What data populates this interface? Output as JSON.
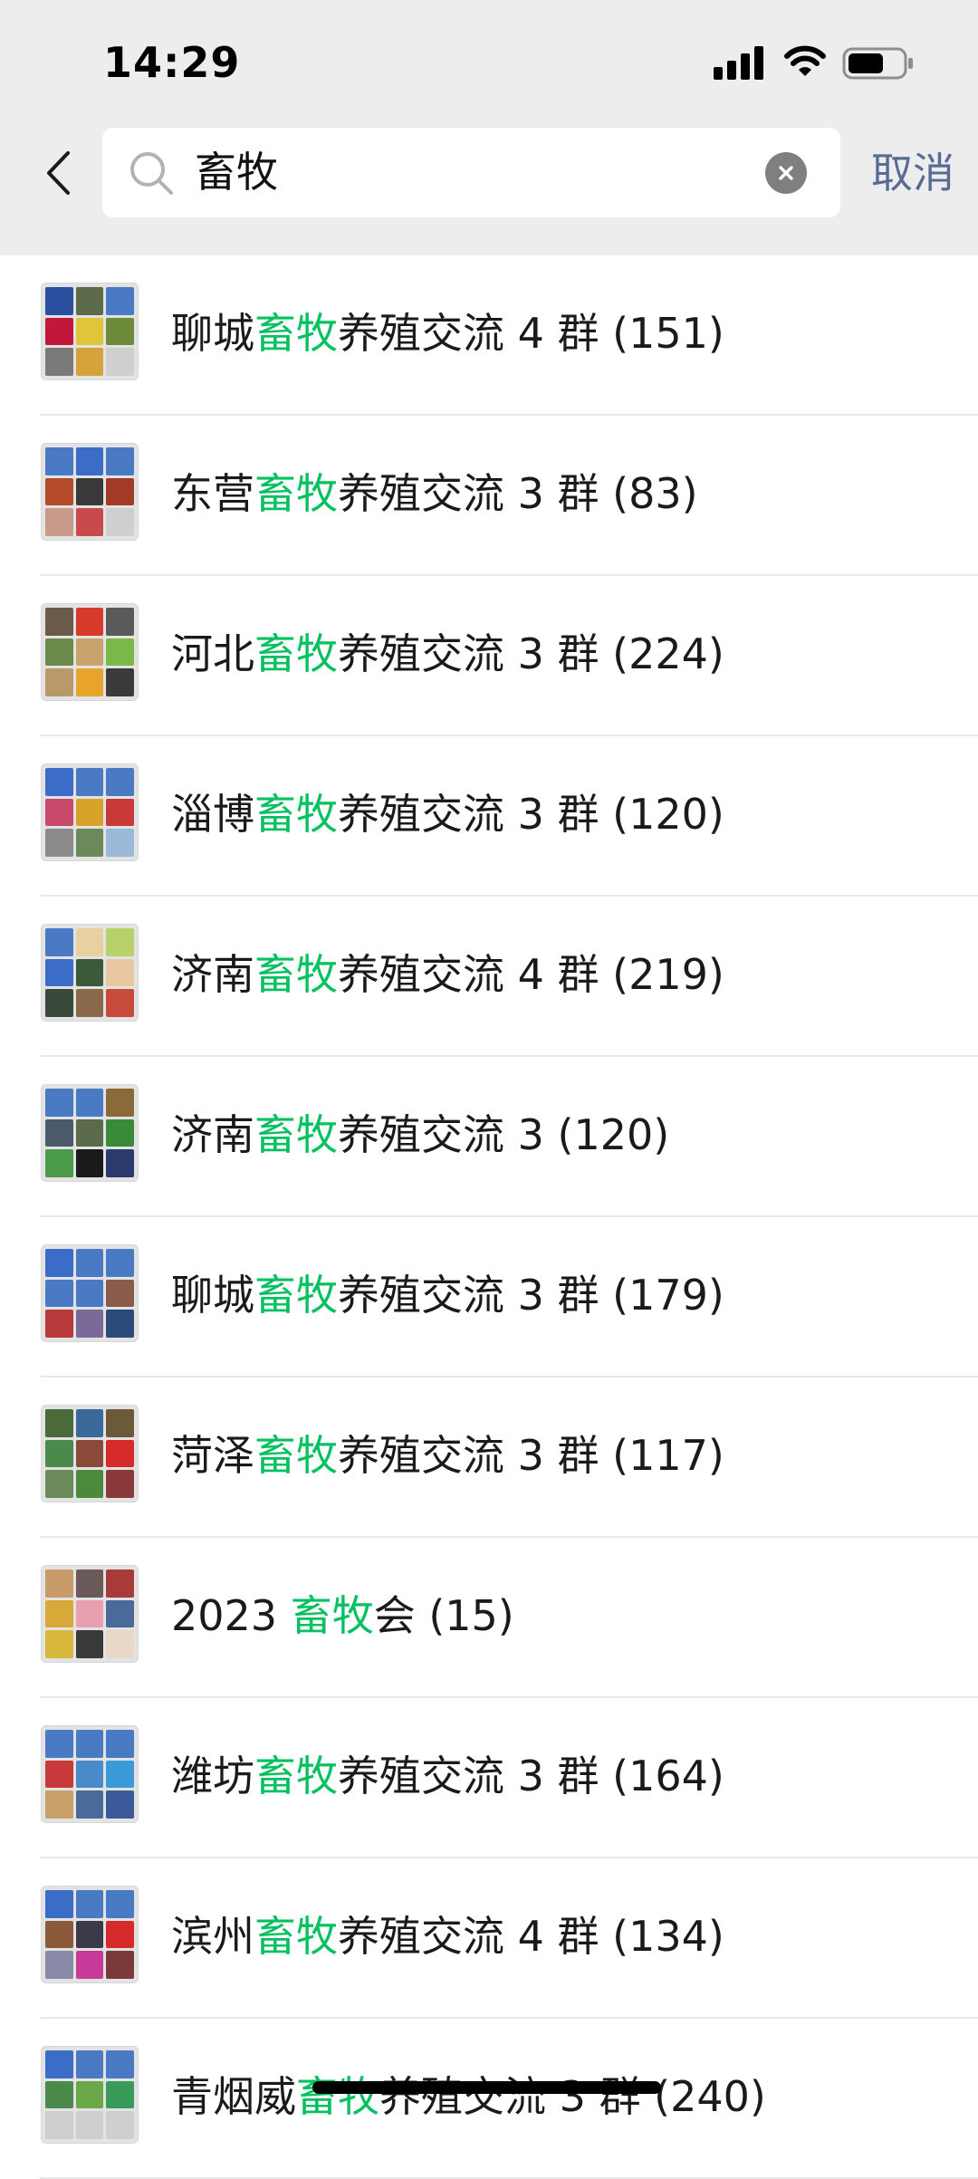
{
  "status_bar": {
    "time": "14:29",
    "icons": [
      "cellular-signal-icon",
      "wifi-icon",
      "battery-icon"
    ]
  },
  "search": {
    "query": "畜牧",
    "cancel_label": "取消",
    "icons": [
      "back-arrow-icon",
      "search-icon",
      "clear-icon"
    ]
  },
  "colors": {
    "highlight": "#07c160",
    "cancel_link": "#576b95",
    "header_bg": "#ededed"
  },
  "results": [
    {
      "prefix": "聊城",
      "highlight": "畜牧",
      "suffix": "养殖交流 4 群 (151)",
      "avatar": [
        "#2a4f9e",
        "#5d6b4a",
        "#4a7ac4",
        "#c2163a",
        "#e0c43a",
        "#6d8a3a",
        "#7a7a7a",
        "#d6a23a",
        "#cfcfcf"
      ]
    },
    {
      "prefix": "东营",
      "highlight": "畜牧",
      "suffix": "养殖交流 3 群 (83)",
      "avatar": [
        "#4a7ac4",
        "#3a6cc8",
        "#4a7ac4",
        "#b44a2a",
        "#3a3a3a",
        "#a23a2a",
        "#c89a8a",
        "#c84a4a",
        "#cfcfcf"
      ]
    },
    {
      "prefix": "河北",
      "highlight": "畜牧",
      "suffix": "养殖交流 3 群 (224)",
      "avatar": [
        "#6b5a4a",
        "#d63a2a",
        "#5a5a5a",
        "#6a8a4a",
        "#c8a36b",
        "#7ab84a",
        "#b89a6a",
        "#e8a32a",
        "#3a3a3a"
      ]
    },
    {
      "prefix": "淄博",
      "highlight": "畜牧",
      "suffix": "养殖交流 3 群 (120)",
      "avatar": [
        "#3a6cc8",
        "#4a7ac4",
        "#4a7ac4",
        "#c84a6a",
        "#d8a32a",
        "#c83a3a",
        "#8a8a8a",
        "#6a8a5a",
        "#9ab8d8"
      ]
    },
    {
      "prefix": "济南",
      "highlight": "畜牧",
      "suffix": "养殖交流 4 群 (219)",
      "avatar": [
        "#4a7ac4",
        "#e8d0a0",
        "#b8d06a",
        "#3a6cc8",
        "#3a5a3a",
        "#e8c8a0",
        "#3a4a3a",
        "#8a6a4a",
        "#c84a3a"
      ]
    },
    {
      "prefix": "济南",
      "highlight": "畜牧",
      "suffix": "养殖交流 3 (120)",
      "avatar": [
        "#4a7ac4",
        "#4a7ac4",
        "#8a6a3a",
        "#4a5a6a",
        "#5a6a4a",
        "#3a8a3a",
        "#4a9a4a",
        "#1a1a1a",
        "#2a3a6a"
      ]
    },
    {
      "prefix": "聊城",
      "highlight": "畜牧",
      "suffix": "养殖交流 3 群 (179)",
      "avatar": [
        "#3a6cc8",
        "#4a7ac4",
        "#4a7ac4",
        "#4a7ac4",
        "#4a7ac4",
        "#8a5a4a",
        "#b83a3a",
        "#7a6a9a",
        "#2a4a7a"
      ]
    },
    {
      "prefix": "菏泽",
      "highlight": "畜牧",
      "suffix": "养殖交流 3 群 (117)",
      "avatar": [
        "#4a6a3a",
        "#3a6a9a",
        "#6a5a3a",
        "#4a8a4a",
        "#8a4a3a",
        "#d62a2a",
        "#6a8a5a",
        "#4a8a3a",
        "#8a3a3a"
      ]
    },
    {
      "prefix": "2023 ",
      "highlight": "畜牧",
      "suffix": "会 (15)",
      "avatar": [
        "#c89a6a",
        "#6a5a5a",
        "#a83a3a",
        "#d8a83a",
        "#e8a0b0",
        "#4a6a9a",
        "#d8b83a",
        "#3a3a3a",
        "#e8d8c8"
      ]
    },
    {
      "prefix": "潍坊",
      "highlight": "畜牧",
      "suffix": "养殖交流 3 群 (164)",
      "avatar": [
        "#4a7ac4",
        "#4a7ac4",
        "#4a7ac4",
        "#c83a3a",
        "#4a8ac8",
        "#3a9ad8",
        "#c8a06a",
        "#4a6a9a",
        "#3a5a9a"
      ]
    },
    {
      "prefix": "滨州",
      "highlight": "畜牧",
      "suffix": "养殖交流 4 群 (134)",
      "avatar": [
        "#3a6cc8",
        "#4a7ac4",
        "#4a7ac4",
        "#8a5a3a",
        "#3a3a4a",
        "#d62a2a",
        "#8a8aa8",
        "#c83a9a",
        "#7a3a3a"
      ]
    },
    {
      "prefix": "青烟威",
      "highlight": "畜牧",
      "suffix": "养殖交流 3 群 (240)",
      "avatar": [
        "#3a6cc8",
        "#4a7ac4",
        "#4a7ac4",
        "#4a8a4a",
        "#6aa84a",
        "#3a9a5a",
        "#cfcfcf",
        "#cfcfcf",
        "#cfcfcf"
      ]
    }
  ]
}
